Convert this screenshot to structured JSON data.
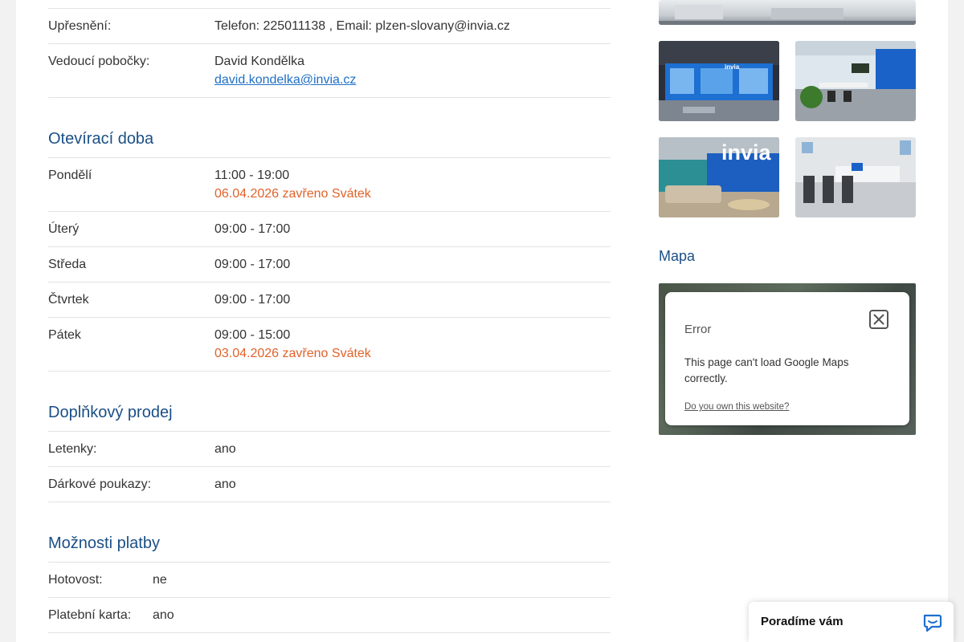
{
  "details": {
    "specification_label": "Upřesnění:",
    "specification_value": "Telefon: 225011138 , Email: plzen-slovany@invia.cz",
    "manager_label": "Vedoucí pobočky:",
    "manager_name": "David Kondělka",
    "manager_email": "david.kondelka@invia.cz"
  },
  "opening_hours": {
    "title": "Otevírací doba",
    "days": [
      {
        "day": "Pondělí",
        "hours": "11:00 - 19:00",
        "note": "06.04.2026 zavřeno Svátek"
      },
      {
        "day": "Úterý",
        "hours": "09:00 - 17:00",
        "note": ""
      },
      {
        "day": "Středa",
        "hours": "09:00 - 17:00",
        "note": ""
      },
      {
        "day": "Čtvrtek",
        "hours": "09:00 - 17:00",
        "note": ""
      },
      {
        "day": "Pátek",
        "hours": "09:00 - 15:00",
        "note": "03.04.2026 zavřeno Svátek"
      }
    ]
  },
  "extra_sales": {
    "title": "Doplňkový prodej",
    "items": [
      {
        "label": "Letenky:",
        "value": "ano"
      },
      {
        "label": "Dárkové poukazy:",
        "value": "ano"
      }
    ]
  },
  "payment": {
    "title": "Možnosti platby",
    "items": [
      {
        "label": "Hotovost:",
        "value": "ne"
      },
      {
        "label": "Platební karta:",
        "value": "ano"
      }
    ]
  },
  "map": {
    "title": "Mapa",
    "error_title": "Error",
    "error_message": "This page can't load Google Maps correctly.",
    "error_link": "Do you own this website?"
  },
  "photos": {
    "logo_text": "invia"
  },
  "chat": {
    "label": "Poradíme vám"
  },
  "colors": {
    "heading": "#1a4f86",
    "holiday_note": "#e0622a",
    "link": "#1f6fc5"
  }
}
